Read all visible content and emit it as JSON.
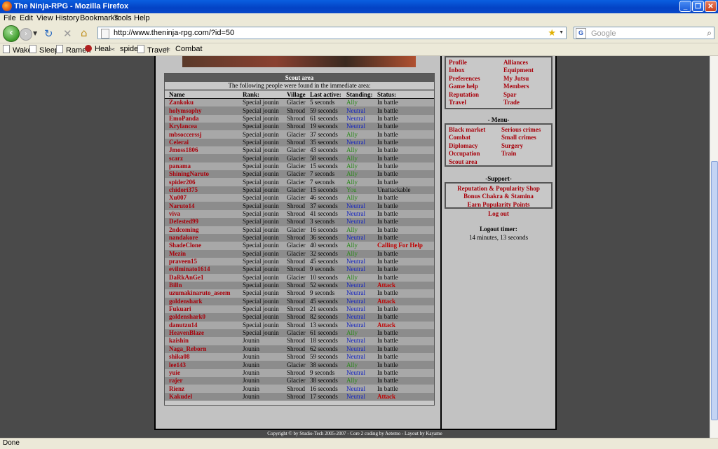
{
  "window": {
    "title": "The Ninja-RPG - Mozilla Firefox"
  },
  "menu": [
    "File",
    "Edit",
    "View",
    "History",
    "Bookmarks",
    "Tools",
    "Help"
  ],
  "nav": {
    "url": "http://www.theninja-rpg.com/?id=50",
    "search_placeholder": "Google"
  },
  "bookmarks": [
    {
      "label": "Wake",
      "icon": "page-icon"
    },
    {
      "label": "Sleep",
      "icon": "page-icon"
    },
    {
      "label": "Ramen",
      "icon": "page-icon"
    },
    {
      "label": "Heal",
      "icon": "red-orb-icon"
    },
    {
      "label": "spider",
      "icon": "scissors-icon"
    },
    {
      "label": "Travel",
      "icon": "page-icon"
    },
    {
      "label": "Combat",
      "icon": "scissors-icon"
    }
  ],
  "scout": {
    "title": "Scout area",
    "subtitle": "The following people were found in the immediate area:",
    "columns": [
      "Name",
      "Rank:",
      "Village",
      "Last active:",
      "Standing:",
      "Status:"
    ],
    "rows": [
      [
        "Zankoku",
        "Special jounin",
        "Glacier",
        "5 seconds",
        "Ally",
        "In battle"
      ],
      [
        "holymsophy",
        "Special jounin",
        "Shroud",
        "59 seconds",
        "Neutral",
        "In battle"
      ],
      [
        "EmoPanda",
        "Special jounin",
        "Shroud",
        "61 seconds",
        "Neutral",
        "In battle"
      ],
      [
        "Krylancea",
        "Special jounin",
        "Shroud",
        "19 seconds",
        "Neutral",
        "In battle"
      ],
      [
        "mbsoccerssj",
        "Special jounin",
        "Glacier",
        "37 seconds",
        "Ally",
        "In battle"
      ],
      [
        "Celerai",
        "Special jounin",
        "Shroud",
        "35 seconds",
        "Neutral",
        "In battle"
      ],
      [
        "Jmoss1806",
        "Special jounin",
        "Glacier",
        "43 seconds",
        "Ally",
        "In battle"
      ],
      [
        "scarz",
        "Special jounin",
        "Glacier",
        "58 seconds",
        "Ally",
        "In battle"
      ],
      [
        "panama",
        "Special jounin",
        "Glacier",
        "15 seconds",
        "Ally",
        "In battle"
      ],
      [
        "ShiningNaruto",
        "Special jounin",
        "Glacier",
        "7 seconds",
        "Ally",
        "In battle"
      ],
      [
        "spider206",
        "Special jounin",
        "Glacier",
        "7 seconds",
        "Ally",
        "In battle"
      ],
      [
        "chidori375",
        "Special jounin",
        "Glacier",
        "15 seconds",
        "You",
        "Unattackable"
      ],
      [
        "Xu007",
        "Special jounin",
        "Glacier",
        "46 seconds",
        "Ally",
        "In battle"
      ],
      [
        "Naruto14",
        "Special jounin",
        "Shroud",
        "37 seconds",
        "Neutral",
        "In battle"
      ],
      [
        "viva",
        "Special jounin",
        "Shroud",
        "41 seconds",
        "Neutral",
        "In battle"
      ],
      [
        "Defested99",
        "Special jounin",
        "Shroud",
        "3 seconds",
        "Neutral",
        "In battle"
      ],
      [
        "2ndcoming",
        "Special jounin",
        "Glacier",
        "16 seconds",
        "Ally",
        "In battle"
      ],
      [
        "nandakore",
        "Special jounin",
        "Shroud",
        "36 seconds",
        "Neutral",
        "In battle"
      ],
      [
        "ShadeClone",
        "Special jounin",
        "Glacier",
        "40 seconds",
        "Ally",
        "Calling For Help"
      ],
      [
        "Mezin",
        "Special jounin",
        "Glacier",
        "32 seconds",
        "Ally",
        "In battle"
      ],
      [
        "praveen15",
        "Special jounin",
        "Shroud",
        "45 seconds",
        "Neutral",
        "In battle"
      ],
      [
        "evilminato1614",
        "Special jounin",
        "Shroud",
        "9 seconds",
        "Neutral",
        "In battle"
      ],
      [
        "DaRkAnGe1",
        "Special jounin",
        "Glacier",
        "10 seconds",
        "Ally",
        "In battle"
      ],
      [
        "Billn",
        "Special jounin",
        "Shroud",
        "52 seconds",
        "Neutral",
        "Attack"
      ],
      [
        "uzumakinaruto_aseem",
        "Special jounin",
        "Shroud",
        "9 seconds",
        "Neutral",
        "In battle"
      ],
      [
        "goldenshark",
        "Special jounin",
        "Shroud",
        "45 seconds",
        "Neutral",
        "Attack"
      ],
      [
        "Fukuari",
        "Special jounin",
        "Shroud",
        "21 seconds",
        "Neutral",
        "In battle"
      ],
      [
        "goldenshark0",
        "Special jounin",
        "Shroud",
        "82 seconds",
        "Neutral",
        "In battle"
      ],
      [
        "danutzu14",
        "Special jounin",
        "Shroud",
        "13 seconds",
        "Neutral",
        "Attack"
      ],
      [
        "HeavenBlaze",
        "Special jounin",
        "Glacier",
        "61 seconds",
        "Ally",
        "In battle"
      ],
      [
        "kaishin",
        "Jounin",
        "Shroud",
        "18 seconds",
        "Neutral",
        "In battle"
      ],
      [
        "Naga_Reborn",
        "Jounin",
        "Shroud",
        "62 seconds",
        "Neutral",
        "In battle"
      ],
      [
        "shika08",
        "Jounin",
        "Shroud",
        "59 seconds",
        "Neutral",
        "In battle"
      ],
      [
        "lee143",
        "Jounin",
        "Glacier",
        "38 seconds",
        "Ally",
        "In battle"
      ],
      [
        "yuie",
        "Jounin",
        "Shroud",
        "9 seconds",
        "Neutral",
        "In battle"
      ],
      [
        "rajer",
        "Jounin",
        "Glacier",
        "38 seconds",
        "Ally",
        "In battle"
      ],
      [
        "Rienz",
        "Jounin",
        "Shroud",
        "16 seconds",
        "Neutral",
        "In battle"
      ],
      [
        "Kakudel",
        "Jounin",
        "Shroud",
        "17 seconds",
        "Neutral",
        "Attack"
      ]
    ]
  },
  "top_menu": {
    "left": [
      "Profile",
      "Inbox",
      "Preferences",
      "Game help",
      "Reputation",
      "Travel"
    ],
    "right": [
      "Alliances",
      "Equipment",
      "My Jutsu",
      "Members",
      "Spar",
      "Trade"
    ]
  },
  "main_menu": {
    "label": "- Menu-",
    "left": [
      "Black market",
      "Combat",
      "Diplomacy",
      "Occupation",
      "Scout area"
    ],
    "right": [
      "Serious crimes",
      "Small crimes",
      "Surgery",
      "Train"
    ]
  },
  "support": {
    "label": "-Support-",
    "items": [
      "Reputation & Popularity Shop",
      "Bonus Chakra & Stamina",
      "Earn Popularity Points"
    ],
    "logout": "Log out",
    "timer_label": "Logout timer:",
    "timer_value": "14 minutes, 13 seconds"
  },
  "copyright": "Copyright © by Studio-Tech 2005-2007 - Core 2 coding by Aetemo - Layout by Kayame",
  "status": "Done"
}
